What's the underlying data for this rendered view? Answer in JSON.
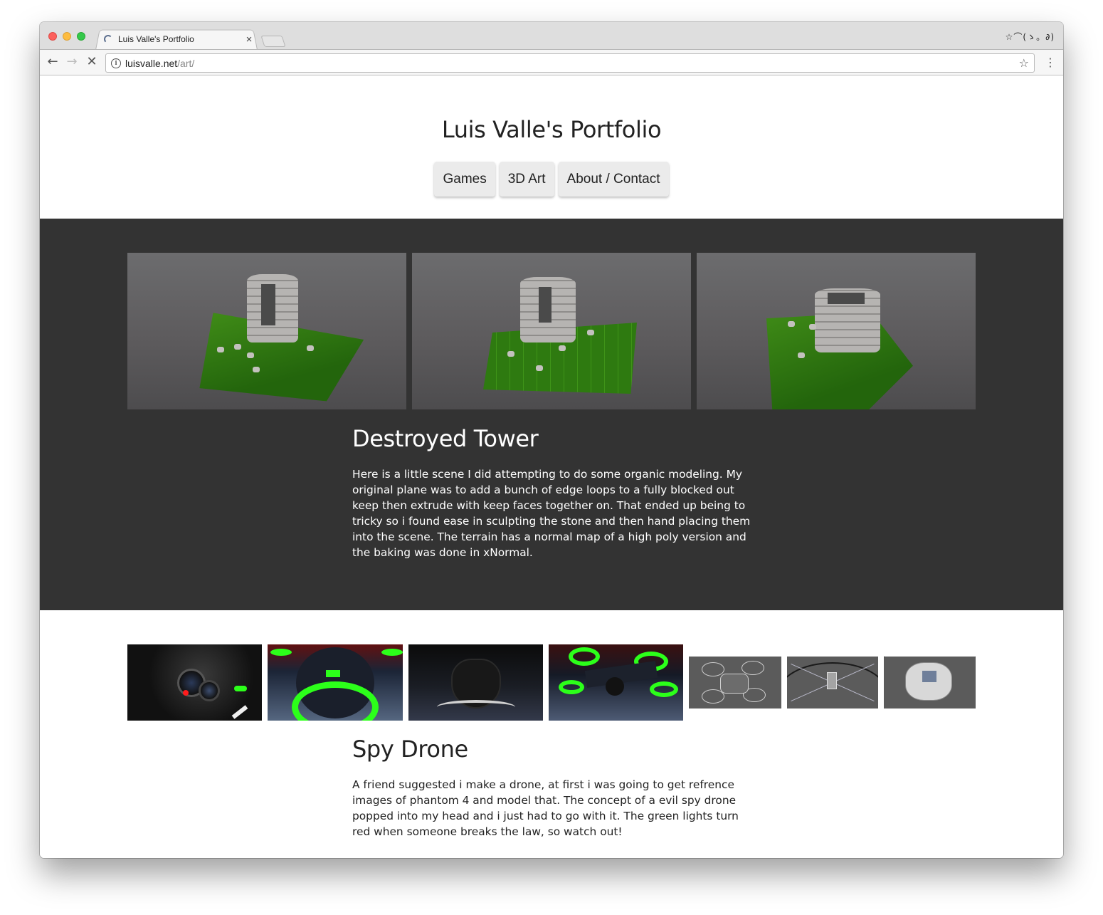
{
  "browser": {
    "tab_title": "Luis Valle's Portfolio",
    "tab_close": "×",
    "url_host": "luisvalle.net",
    "url_path": "/art/",
    "extension_text": "☆⌒(ゝ。∂)"
  },
  "site": {
    "title": "Luis Valle's Portfolio",
    "nav": [
      "Games",
      "3D Art",
      "About / Contact"
    ]
  },
  "projects": [
    {
      "title": "Destroyed Tower",
      "image_count": 3,
      "description": "Here is a little scene I did attempting to do some organic modeling. My original plane was to add a bunch of edge loops to a fully blocked out keep then extrude with keep faces together on. That ended up being to tricky so i found ease in sculpting the stone and then hand placing them into the scene. The terrain has a normal map of a high poly version and the baking was done in xNormal."
    },
    {
      "title": "Spy Drone",
      "image_count": 7,
      "description": "A friend suggested i make a drone, at first i was going to get refrence images of phantom 4 and model that. The concept of a evil spy drone popped into my head and i just had to go with it. The green lights turn red when someone breaks the law, so watch out!"
    }
  ],
  "colors": {
    "dark_section": "#333333",
    "drone_green": "#2cff1a",
    "grass_green": "#3f8b17"
  }
}
